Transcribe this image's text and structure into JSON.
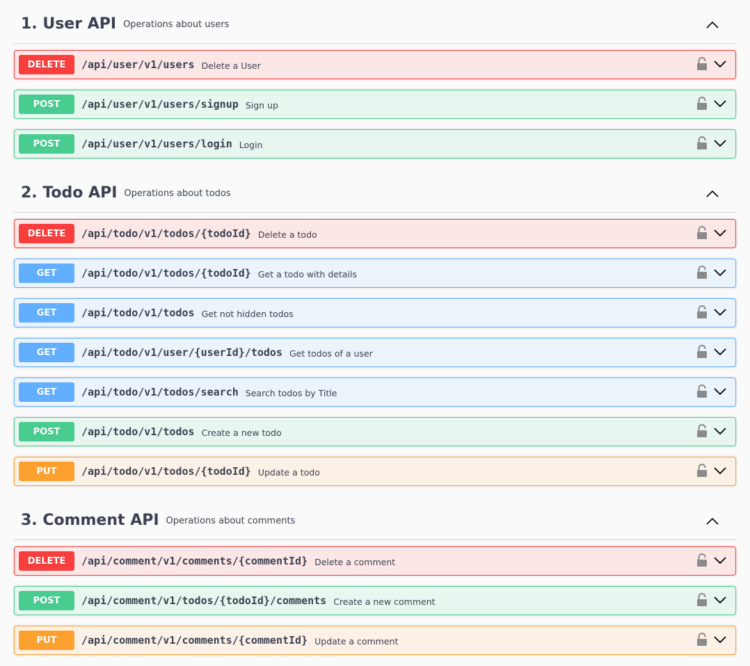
{
  "sections": [
    {
      "title": "1. User API",
      "description": "Operations about users",
      "operations": [
        {
          "method": "DELETE",
          "path": "/api/user/v1/users",
          "summary": "Delete a User"
        },
        {
          "method": "POST",
          "path": "/api/user/v1/users/signup",
          "summary": "Sign up"
        },
        {
          "method": "POST",
          "path": "/api/user/v1/users/login",
          "summary": "Login"
        }
      ]
    },
    {
      "title": "2. Todo API",
      "description": "Operations about todos",
      "operations": [
        {
          "method": "DELETE",
          "path": "/api/todo/v1/todos/{todoId}",
          "summary": "Delete a todo"
        },
        {
          "method": "GET",
          "path": "/api/todo/v1/todos/{todoId}",
          "summary": "Get a todo with details"
        },
        {
          "method": "GET",
          "path": "/api/todo/v1/todos",
          "summary": "Get not hidden todos"
        },
        {
          "method": "GET",
          "path": "/api/todo/v1/user/{userId}/todos",
          "summary": "Get todos of a user"
        },
        {
          "method": "GET",
          "path": "/api/todo/v1/todos/search",
          "summary": "Search todos by Title"
        },
        {
          "method": "POST",
          "path": "/api/todo/v1/todos",
          "summary": "Create a new todo"
        },
        {
          "method": "PUT",
          "path": "/api/todo/v1/todos/{todoId}",
          "summary": "Update a todo"
        }
      ]
    },
    {
      "title": "3. Comment API",
      "description": "Operations about comments",
      "operations": [
        {
          "method": "DELETE",
          "path": "/api/comment/v1/comments/{commentId}",
          "summary": "Delete a comment"
        },
        {
          "method": "POST",
          "path": "/api/comment/v1/todos/{todoId}/comments",
          "summary": "Create a new comment"
        },
        {
          "method": "PUT",
          "path": "/api/comment/v1/comments/{commentId}",
          "summary": "Update a comment"
        }
      ]
    }
  ],
  "icons": {
    "section_toggle": "chevron-up-icon",
    "operation_lock": "lock-icon",
    "operation_toggle": "chevron-down-icon"
  },
  "colors": {
    "DELETE": "#f93e3e",
    "POST": "#49cc90",
    "GET": "#61affe",
    "PUT": "#fca130"
  }
}
